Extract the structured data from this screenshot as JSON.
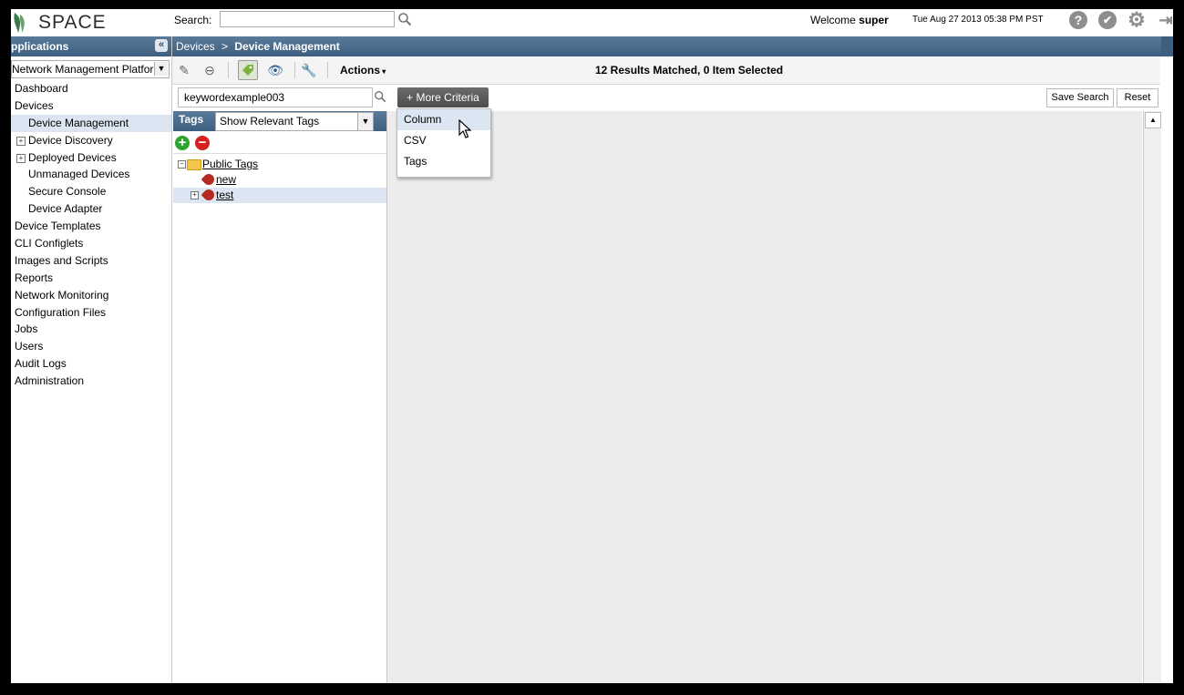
{
  "header": {
    "logo_text": "SPACE",
    "search_label": "Search:",
    "search_value": "",
    "welcome_prefix": "Welcome",
    "welcome_user": "super",
    "datetime": "Tue Aug 27 2013 05:38 PM PST",
    "help_icon": "?",
    "check_icon": "✔",
    "gear_icon": "⚙",
    "logout_icon": "⇥"
  },
  "left": {
    "title": "Applications",
    "title_visible": "pplications",
    "collapse_glyph": "«",
    "platform_select": "Network Management Platform",
    "platform_visible": "Network Management Platform",
    "nav": [
      {
        "label": "Dashboard",
        "level": 0
      },
      {
        "label": "Devices",
        "level": 0
      },
      {
        "label": "Device Management",
        "level": 1,
        "selected": true
      },
      {
        "label": "Device Discovery",
        "level": 1,
        "expander": "+"
      },
      {
        "label": "Deployed Devices",
        "level": 1,
        "expander": "+"
      },
      {
        "label": "Unmanaged Devices",
        "level": 1
      },
      {
        "label": "Secure Console",
        "level": 1
      },
      {
        "label": "Device Adapter",
        "level": 1
      },
      {
        "label": "Device Templates",
        "level": 0
      },
      {
        "label": "CLI Configlets",
        "level": 0
      },
      {
        "label": "Images and Scripts",
        "level": 0
      },
      {
        "label": "Reports",
        "level": 0
      },
      {
        "label": "Network Monitoring",
        "level": 0
      },
      {
        "label": "Configuration Files",
        "level": 0
      },
      {
        "label": "Jobs",
        "level": 0
      },
      {
        "label": "Users",
        "level": 0
      },
      {
        "label": "Audit Logs",
        "level": 0
      },
      {
        "label": "Administration",
        "level": 0
      }
    ]
  },
  "breadcrumb": {
    "parent": "Devices",
    "separator": ">",
    "current": "Device Management"
  },
  "toolbar": {
    "actions_label": "Actions",
    "status": "12 Results Matched, 0 Item Selected"
  },
  "criteria": {
    "keyword": "keywordexample003",
    "more_criteria": "+ More Criteria",
    "save_search": "Save Search",
    "reset": "Reset",
    "menu": [
      "Column",
      "CSV",
      "Tags"
    ]
  },
  "tags": {
    "title": "Tags",
    "filter": "Show Relevant Tags",
    "tree": {
      "root": "Public Tags",
      "children": [
        "new",
        "test"
      ]
    }
  },
  "colors": {
    "header_blue": "#3f5f80",
    "selection": "#dbe6f2",
    "tag_red": "#b42a1e",
    "add_green": "#2ea32e",
    "remove_red": "#d62020"
  }
}
